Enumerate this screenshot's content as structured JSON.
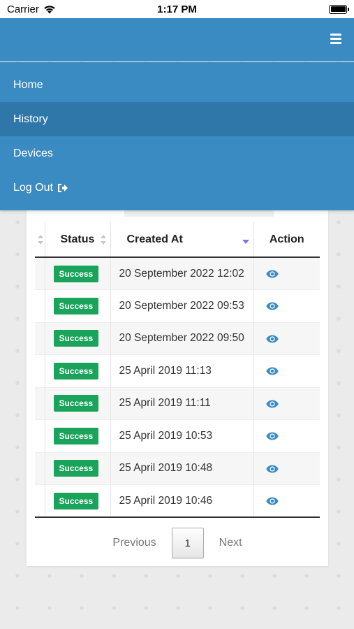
{
  "status_bar": {
    "carrier": "Carrier",
    "time": "1:17 PM",
    "icons": [
      "wifi-icon",
      "battery-icon"
    ]
  },
  "navbar": {
    "menu_icon": "hamburger-icon",
    "bg_color": "#3a8bc1"
  },
  "menu": {
    "items": [
      {
        "label": "Home"
      },
      {
        "label": "History",
        "active": true
      },
      {
        "label": "Devices"
      },
      {
        "label": "Log Out",
        "icon": "logout-icon"
      }
    ]
  },
  "table": {
    "headers": {
      "status": "Status",
      "created_at": "Created At",
      "action": "Action"
    },
    "sort": {
      "column": "created_at",
      "direction": "desc"
    },
    "rows": [
      {
        "status": "Success",
        "created_at": "20 September 2022 12:02",
        "action_icon": "eye-icon"
      },
      {
        "status": "Success",
        "created_at": "20 September 2022 09:53",
        "action_icon": "eye-icon"
      },
      {
        "status": "Success",
        "created_at": "20 September 2022 09:50",
        "action_icon": "eye-icon"
      },
      {
        "status": "Success",
        "created_at": "25 April 2019 11:13",
        "action_icon": "eye-icon"
      },
      {
        "status": "Success",
        "created_at": "25 April 2019 11:11",
        "action_icon": "eye-icon"
      },
      {
        "status": "Success",
        "created_at": "25 April 2019 10:53",
        "action_icon": "eye-icon"
      },
      {
        "status": "Success",
        "created_at": "25 April 2019 10:48",
        "action_icon": "eye-icon"
      },
      {
        "status": "Success",
        "created_at": "25 April 2019 10:46",
        "action_icon": "eye-icon"
      }
    ],
    "status_color": "#1aa35a",
    "action_color": "#3a8bc1"
  },
  "pagination": {
    "previous": "Previous",
    "current": "1",
    "next": "Next"
  }
}
